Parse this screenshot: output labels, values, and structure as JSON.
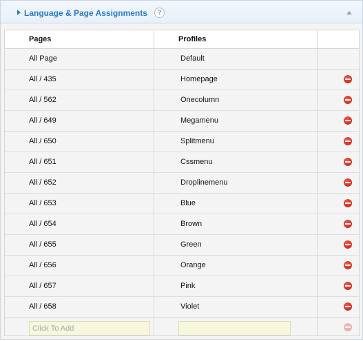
{
  "panel": {
    "title": "Language & Page Assignments",
    "help_label": "?"
  },
  "table": {
    "columns": [
      "Pages",
      "Profiles",
      ""
    ],
    "rows": [
      {
        "page": "All Page",
        "profile": "Default",
        "removable": false
      },
      {
        "page": "All / 435",
        "profile": "Homepage",
        "removable": true
      },
      {
        "page": "All / 562",
        "profile": "Onecolumn",
        "removable": true
      },
      {
        "page": "All / 649",
        "profile": "Megamenu",
        "removable": true
      },
      {
        "page": "All / 650",
        "profile": "Splitmenu",
        "removable": true
      },
      {
        "page": "All / 651",
        "profile": "Cssmenu",
        "removable": true
      },
      {
        "page": "All / 652",
        "profile": "Droplinemenu",
        "removable": true
      },
      {
        "page": "All / 653",
        "profile": "Blue",
        "removable": true
      },
      {
        "page": "All / 654",
        "profile": "Brown",
        "removable": true
      },
      {
        "page": "All / 655",
        "profile": "Green",
        "removable": true
      },
      {
        "page": "All / 656",
        "profile": "Orange",
        "removable": true
      },
      {
        "page": "All / 657",
        "profile": "Pink",
        "removable": true
      },
      {
        "page": "All / 658",
        "profile": "Violet",
        "removable": true
      }
    ],
    "add_row": {
      "page_placeholder": "Click To Add",
      "profile_placeholder": ""
    }
  },
  "colors": {
    "accent": "#2a7bc0",
    "remove": "#d0281a",
    "add_field": "#f7f7dc"
  },
  "icons": {
    "toggle": "caret-right-icon",
    "help": "help-icon",
    "collapse": "caret-up-icon",
    "remove": "remove-icon"
  }
}
